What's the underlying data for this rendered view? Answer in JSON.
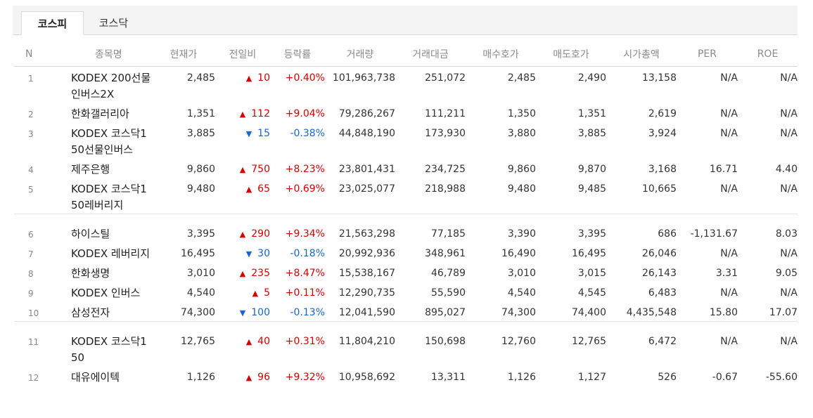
{
  "tabs": [
    {
      "label": "코스피",
      "active": true
    },
    {
      "label": "코스닥",
      "active": false
    }
  ],
  "columns": [
    "N",
    "종목명",
    "현재가",
    "전일비",
    "등락률",
    "거래량",
    "거래대금",
    "매수호가",
    "매도호가",
    "시가총액",
    "PER",
    "ROE"
  ],
  "colors": {
    "up": "#d60000",
    "down": "#1766d3"
  },
  "rows": [
    {
      "n": "1",
      "name": "KODEX 200선물인버스2X",
      "price": "2,485",
      "dir": "up",
      "diff": "10",
      "rate": "+0.40%",
      "volume": "101,963,738",
      "amount": "251,072",
      "bid": "2,485",
      "ask": "2,490",
      "cap": "13,158",
      "per": "N/A",
      "roe": "N/A"
    },
    {
      "n": "2",
      "name": "한화갤러리아",
      "price": "1,351",
      "dir": "up",
      "diff": "112",
      "rate": "+9.04%",
      "volume": "79,286,267",
      "amount": "111,211",
      "bid": "1,350",
      "ask": "1,351",
      "cap": "2,619",
      "per": "N/A",
      "roe": "N/A"
    },
    {
      "n": "3",
      "name": "KODEX 코스닥150선물인버스",
      "price": "3,885",
      "dir": "down",
      "diff": "15",
      "rate": "-0.38%",
      "volume": "44,848,190",
      "amount": "173,930",
      "bid": "3,880",
      "ask": "3,885",
      "cap": "3,924",
      "per": "N/A",
      "roe": "N/A"
    },
    {
      "n": "4",
      "name": "제주은행",
      "price": "9,860",
      "dir": "up",
      "diff": "750",
      "rate": "+8.23%",
      "volume": "23,801,431",
      "amount": "234,725",
      "bid": "9,860",
      "ask": "9,870",
      "cap": "3,168",
      "per": "16.71",
      "roe": "4.40"
    },
    {
      "n": "5",
      "name": "KODEX 코스닥150레버리지",
      "price": "9,480",
      "dir": "up",
      "diff": "65",
      "rate": "+0.69%",
      "volume": "23,025,077",
      "amount": "218,988",
      "bid": "9,480",
      "ask": "9,485",
      "cap": "10,665",
      "per": "N/A",
      "roe": "N/A"
    },
    {
      "n": "6",
      "name": "하이스틸",
      "price": "3,395",
      "dir": "up",
      "diff": "290",
      "rate": "+9.34%",
      "volume": "21,563,298",
      "amount": "77,185",
      "bid": "3,390",
      "ask": "3,395",
      "cap": "686",
      "per": "-1,131.67",
      "roe": "8.03"
    },
    {
      "n": "7",
      "name": "KODEX 레버리지",
      "price": "16,495",
      "dir": "down",
      "diff": "30",
      "rate": "-0.18%",
      "volume": "20,992,936",
      "amount": "348,961",
      "bid": "16,490",
      "ask": "16,495",
      "cap": "26,046",
      "per": "N/A",
      "roe": "N/A"
    },
    {
      "n": "8",
      "name": "한화생명",
      "price": "3,010",
      "dir": "up",
      "diff": "235",
      "rate": "+8.47%",
      "volume": "15,538,167",
      "amount": "46,789",
      "bid": "3,010",
      "ask": "3,015",
      "cap": "26,143",
      "per": "3.31",
      "roe": "9.05"
    },
    {
      "n": "9",
      "name": "KODEX 인버스",
      "price": "4,540",
      "dir": "up",
      "diff": "5",
      "rate": "+0.11%",
      "volume": "12,290,735",
      "amount": "55,590",
      "bid": "4,540",
      "ask": "4,545",
      "cap": "6,483",
      "per": "N/A",
      "roe": "N/A"
    },
    {
      "n": "10",
      "name": "삼성전자",
      "price": "74,300",
      "dir": "down",
      "diff": "100",
      "rate": "-0.13%",
      "volume": "12,041,590",
      "amount": "895,027",
      "bid": "74,300",
      "ask": "74,400",
      "cap": "4,435,548",
      "per": "15.80",
      "roe": "17.07"
    },
    {
      "n": "11",
      "name": "KODEX 코스닥150",
      "price": "12,765",
      "dir": "up",
      "diff": "40",
      "rate": "+0.31%",
      "volume": "11,804,210",
      "amount": "150,698",
      "bid": "12,760",
      "ask": "12,765",
      "cap": "6,472",
      "per": "N/A",
      "roe": "N/A"
    },
    {
      "n": "12",
      "name": "대유에이텍",
      "price": "1,126",
      "dir": "up",
      "diff": "96",
      "rate": "+9.32%",
      "volume": "10,958,692",
      "amount": "13,311",
      "bid": "1,126",
      "ask": "1,127",
      "cap": "526",
      "per": "-0.67",
      "roe": "-55.60"
    }
  ]
}
